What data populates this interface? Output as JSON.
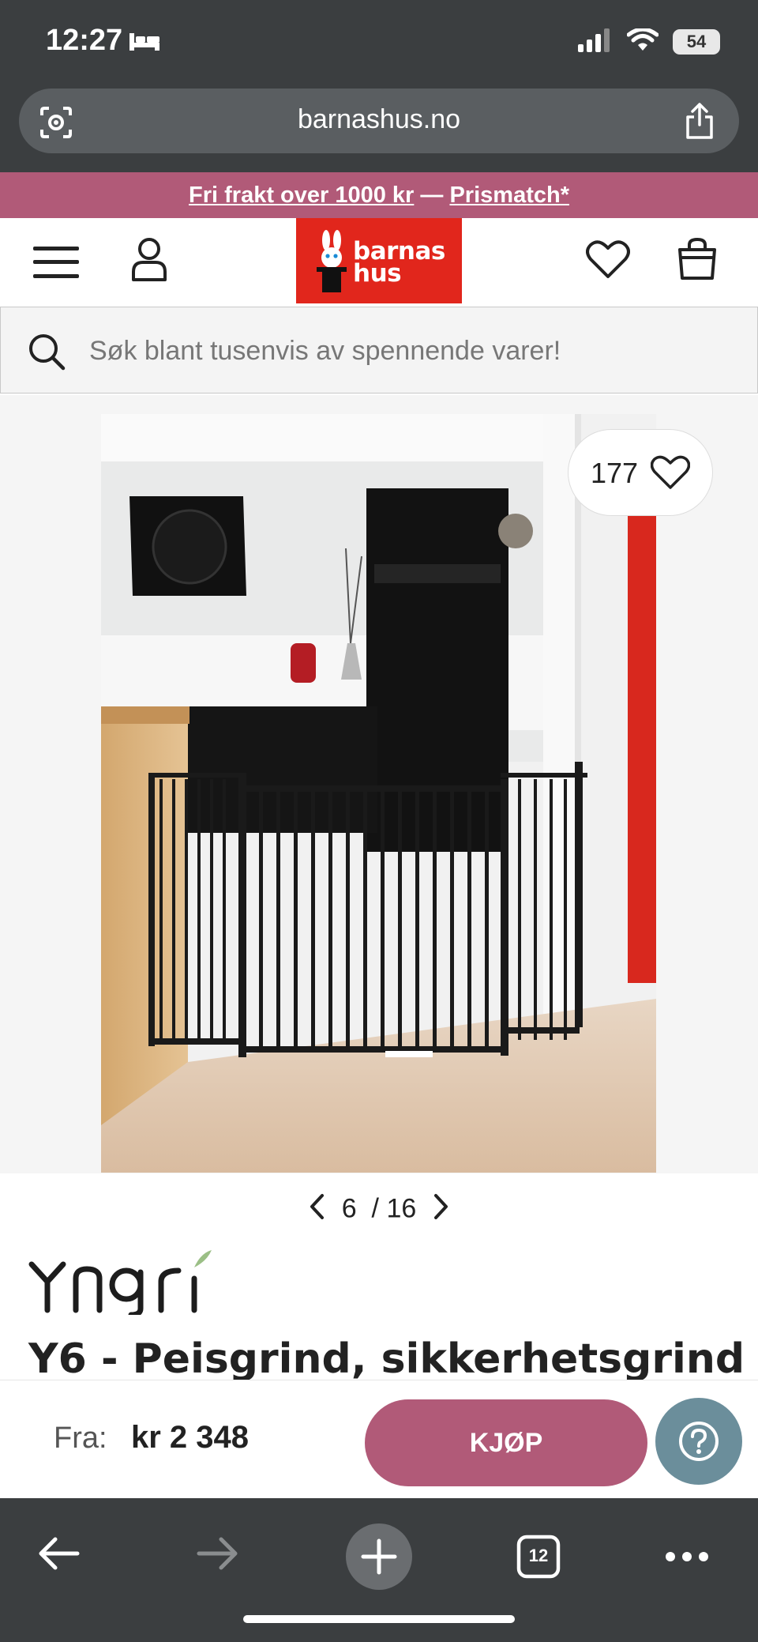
{
  "status_bar": {
    "time": "12:27",
    "battery": "54"
  },
  "browser": {
    "url": "barnashus.no",
    "tabs_count": "12"
  },
  "promo": {
    "free_shipping": "Fri frakt over 1000 kr",
    "separator": " — ",
    "price_match": "Prismatch*"
  },
  "header": {
    "logo_line1": "barnas",
    "logo_line2": "hus"
  },
  "search": {
    "placeholder": "Søk blant tusenvis av spennende varer!"
  },
  "gallery": {
    "like_count": "177",
    "current": "6",
    "total": "/ 16"
  },
  "product": {
    "brand": "Yngri",
    "title": "Y6 - Peisgrind, sikkerhetsgrind"
  },
  "buy": {
    "from_label": "Fra:",
    "price": "kr 2 348",
    "buy_label": "KJØP"
  },
  "colors": {
    "brand_red": "#e1261c",
    "accent_pink": "#b15a78",
    "help_blue": "#6b8e9b",
    "chrome": "#3b3e40"
  }
}
